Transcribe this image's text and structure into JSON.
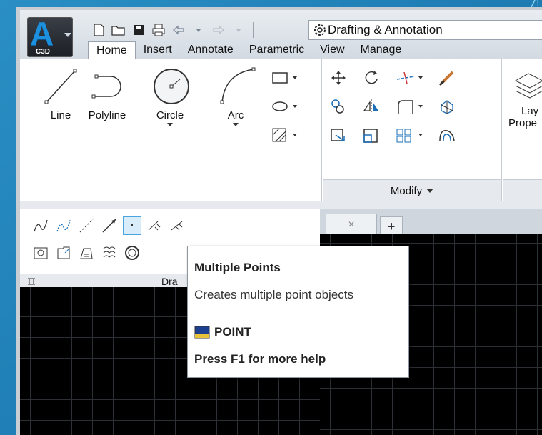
{
  "app": {
    "badge": "C3D"
  },
  "workspace": {
    "label": "Drafting & Annotation"
  },
  "tabs": [
    "Home",
    "Insert",
    "Annotate",
    "Parametric",
    "View",
    "Manage"
  ],
  "draw_tools": {
    "line": "Line",
    "polyline": "Polyline",
    "circle": "Circle",
    "arc": "Arc"
  },
  "layer_tool": {
    "line1": "Lay",
    "line2": "Prope"
  },
  "panels": {
    "modify": "Modify",
    "draw": "Dra"
  },
  "file_tab": {
    "close": "×",
    "new": "+"
  },
  "tooltip": {
    "title": "Multiple Points",
    "description": "Creates multiple point objects",
    "command": "POINT",
    "help": "Press F1 for more help"
  },
  "colors": {
    "accent": "#1d8fdf",
    "background": "#2a8fc4",
    "selection": "#d9ecf9"
  }
}
